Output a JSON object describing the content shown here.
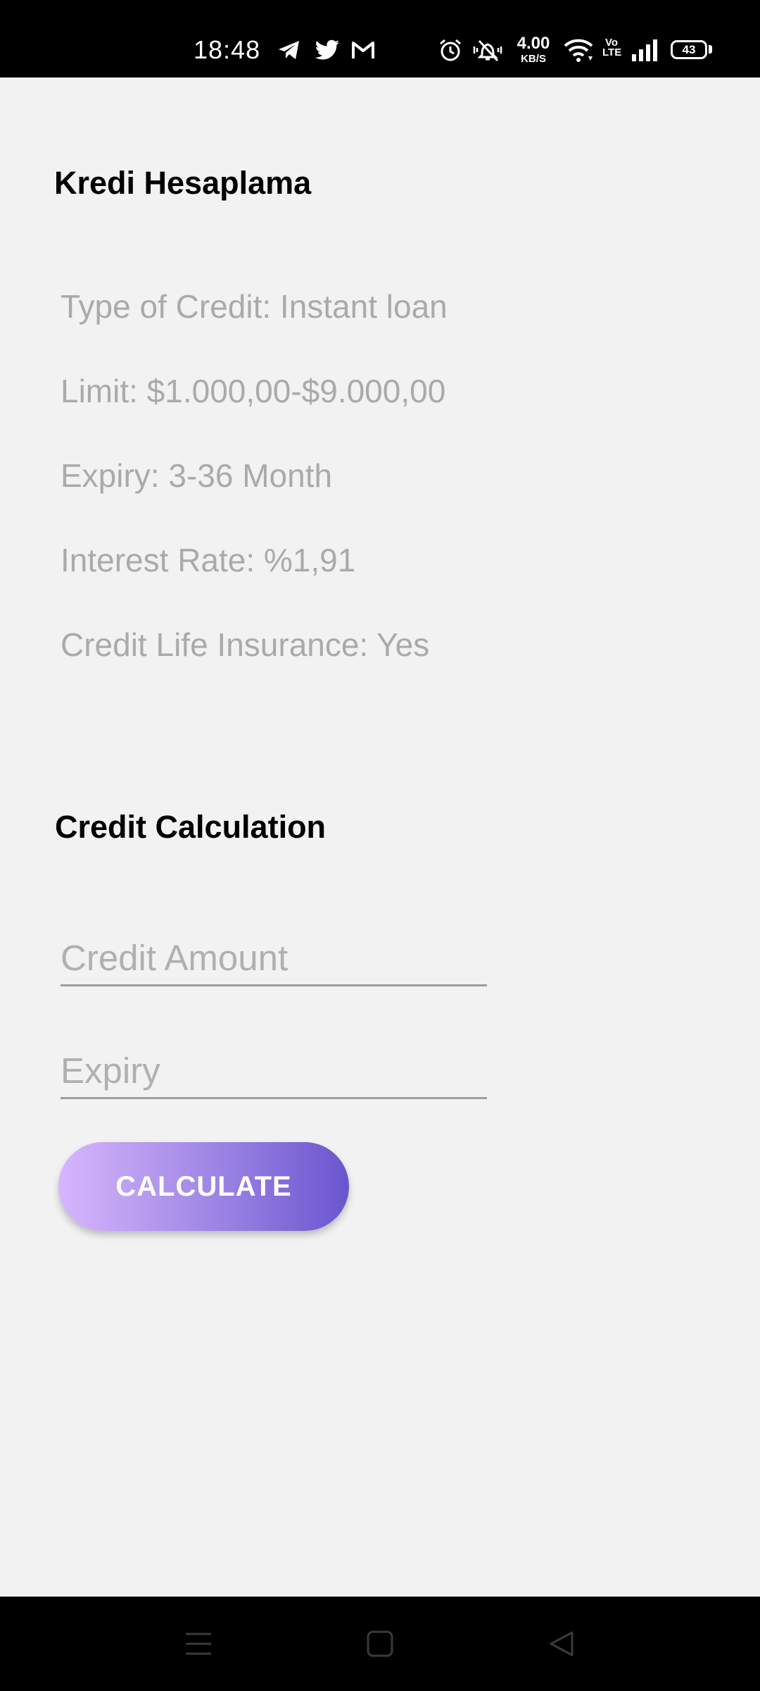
{
  "status_bar": {
    "time": "18:48",
    "net_speed_value": "4.00",
    "net_speed_unit": "KB/S",
    "volte_top": "Vo",
    "volte_bottom": "LTE",
    "battery_level": "43",
    "icons": [
      "telegram-icon",
      "twitter-icon",
      "gmail-icon",
      "alarm-icon",
      "silent-bell-icon",
      "wifi-icon",
      "signal-icon",
      "battery-icon"
    ]
  },
  "app": {
    "title": "Kredi Hesaplama"
  },
  "credit_info": {
    "type": "Type of Credit: Instant loan",
    "limit": "Limit: $1.000,00-$9.000,00",
    "expiry": "Expiry: 3-36 Month",
    "interest_rate": "Interest Rate: %1,91",
    "insurance": "Credit Life Insurance: Yes"
  },
  "calculation": {
    "title": "Credit Calculation",
    "amount_placeholder": "Credit Amount",
    "amount_value": "",
    "expiry_placeholder": "Expiry",
    "expiry_value": "",
    "button_label": "CALCULATE"
  },
  "nav_bar": {
    "icons": [
      "menu-icon",
      "home-icon",
      "back-icon"
    ]
  },
  "colors": {
    "background": "#f2f2f2",
    "info_text": "#aaaaaa",
    "button_gradient_start": "#d7b6fd",
    "button_gradient_end": "#6a55cf"
  }
}
